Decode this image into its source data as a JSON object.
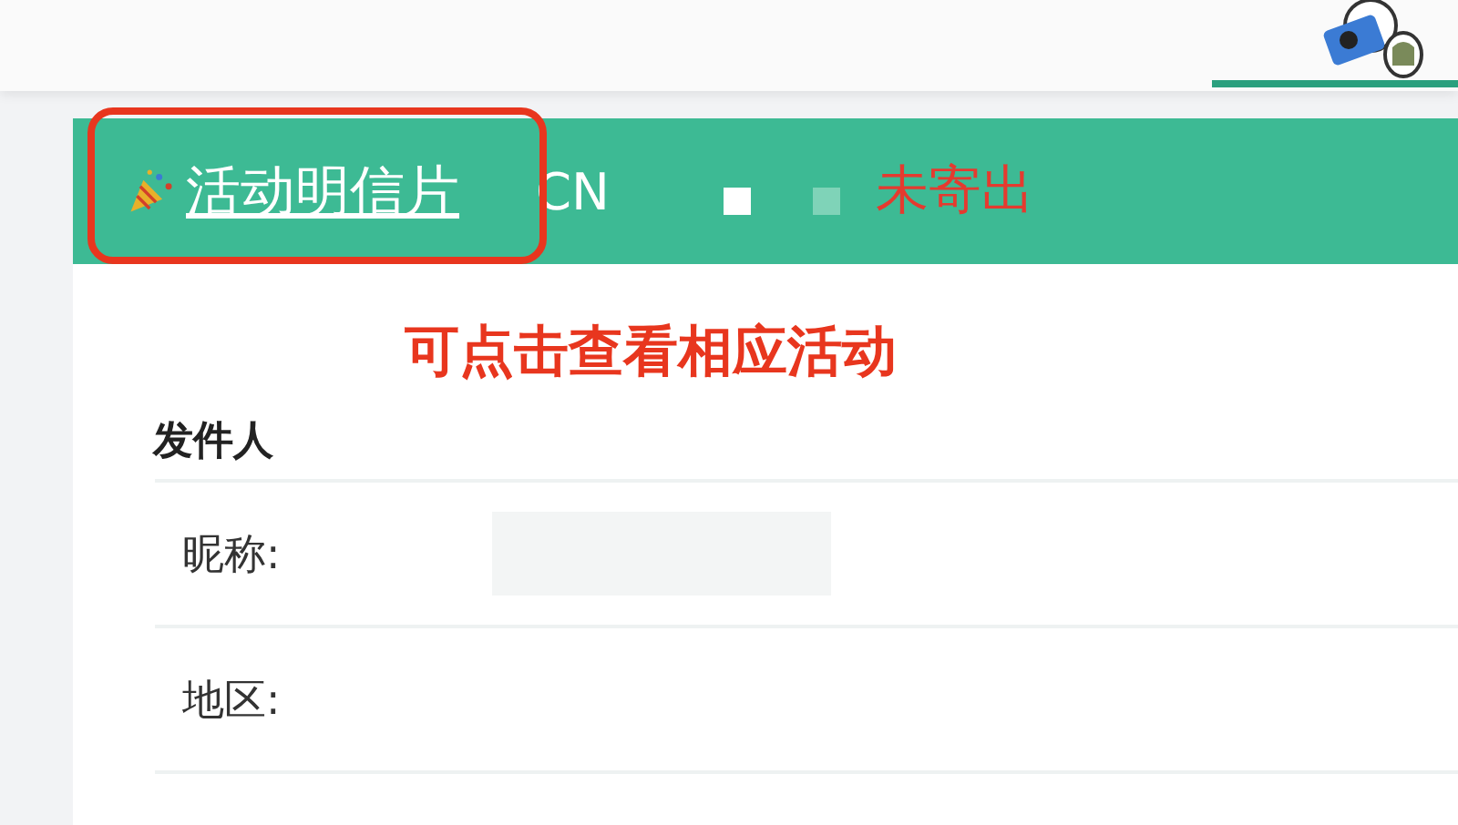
{
  "card": {
    "postcard_link": "活动明信片",
    "country": "CN",
    "status": "未寄出"
  },
  "annotation": "可点击查看相应活动",
  "sender": {
    "title": "发件人",
    "fields": [
      {
        "label": "昵称:",
        "redacted": true
      },
      {
        "label": "地区:",
        "redacted": false
      }
    ]
  }
}
